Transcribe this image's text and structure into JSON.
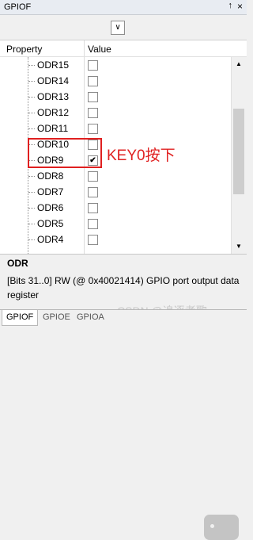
{
  "window": {
    "title": "GPIOF",
    "pin_glyph": "↑",
    "close_glyph": "×"
  },
  "toolbar": {
    "dropdown_glyph": "∨"
  },
  "columns": {
    "property": "Property",
    "value": "Value"
  },
  "rows": [
    {
      "name": "ODR15",
      "checked": false
    },
    {
      "name": "ODR14",
      "checked": false
    },
    {
      "name": "ODR13",
      "checked": false
    },
    {
      "name": "ODR12",
      "checked": false
    },
    {
      "name": "ODR11",
      "checked": false
    },
    {
      "name": "ODR10",
      "checked": false
    },
    {
      "name": "ODR9",
      "checked": true
    },
    {
      "name": "ODR8",
      "checked": false
    },
    {
      "name": "ODR7",
      "checked": false
    },
    {
      "name": "ODR6",
      "checked": false
    },
    {
      "name": "ODR5",
      "checked": false
    },
    {
      "name": "ODR4",
      "checked": false
    }
  ],
  "annotation": {
    "text": "KEY0按下",
    "color": "#e02020"
  },
  "description": {
    "title": "ODR",
    "text": "[Bits 31..0] RW (@ 0x40021414) GPIO port output data register"
  },
  "watermark": "CSDN @追逐者歌",
  "tabs": [
    {
      "label": "GPIOF",
      "active": true
    },
    {
      "label": "GPIOE",
      "active": false
    },
    {
      "label": "GPIOA",
      "active": false
    }
  ],
  "scrollbar": {
    "up_glyph": "▲",
    "down_glyph": "▼"
  },
  "check_glyph": "✔"
}
